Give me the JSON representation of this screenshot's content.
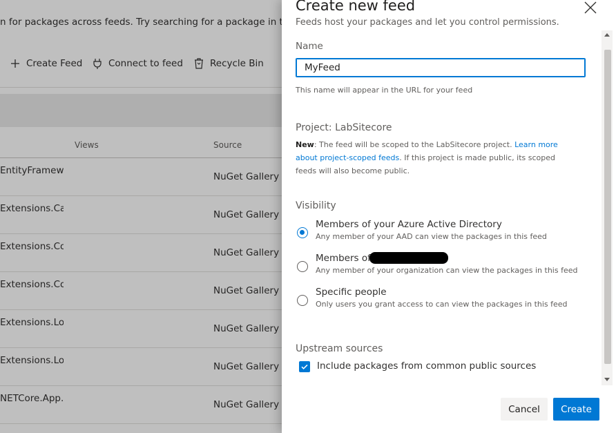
{
  "background": {
    "banner_text": "n for packages across feeds. Try searching for a package in the search",
    "toolbar": {
      "create_feed": "Create Feed",
      "connect_to_feed": "Connect to feed",
      "recycle_bin": "Recycle Bin"
    },
    "columns": {
      "views": "Views",
      "source": "Source"
    },
    "rows": [
      {
        "package": "EntityFrameworkCore",
        "source": "NuGet Gallery"
      },
      {
        "package": "Extensions.Caching",
        "source": "NuGet Gallery"
      },
      {
        "package": "Extensions.Configuration",
        "source": "NuGet Gallery"
      },
      {
        "package": "Extensions.Configuration",
        "source": "NuGet Gallery"
      },
      {
        "package": "Extensions.Logging",
        "source": "NuGet Gallery"
      },
      {
        "package": "Extensions.Logging",
        "source": "NuGet Gallery"
      },
      {
        "package": "NETCore.App.",
        "source": "NuGet Gallery"
      }
    ]
  },
  "panel": {
    "title": "Create new feed",
    "subtitle": "Feeds host your packages and let you control permissions.",
    "name": {
      "label": "Name",
      "value": "MyFeed",
      "hint": "This name will appear in the URL for your feed"
    },
    "project": {
      "title": "Project: LabSitecore",
      "desc_bold": "New",
      "desc_part1": ": The feed will be scoped to the LabSitecore project. ",
      "desc_link": "Learn more about project-scoped feeds",
      "desc_part2": ". If this project is made public, its scoped feeds will also become public."
    },
    "visibility": {
      "title": "Visibility",
      "options": [
        {
          "label": "Members of your Azure Active Directory",
          "desc": "Any member of your AAD can view the packages in this feed",
          "selected": true
        },
        {
          "label": "Members of",
          "desc": "Any member of your organization can view the packages in this feed",
          "selected": false
        },
        {
          "label": "Specific people",
          "desc": "Only users you grant access to can view the packages in this feed",
          "selected": false
        }
      ]
    },
    "upstream": {
      "title": "Upstream sources",
      "checkbox_label": "Include packages from common public sources",
      "checked": true
    },
    "buttons": {
      "cancel": "Cancel",
      "create": "Create"
    }
  },
  "colors": {
    "accent": "#0078d4",
    "overlay": "rgba(0,0,0,0.25)",
    "text_primary": "#201f1e",
    "text_secondary": "#605e5c"
  }
}
